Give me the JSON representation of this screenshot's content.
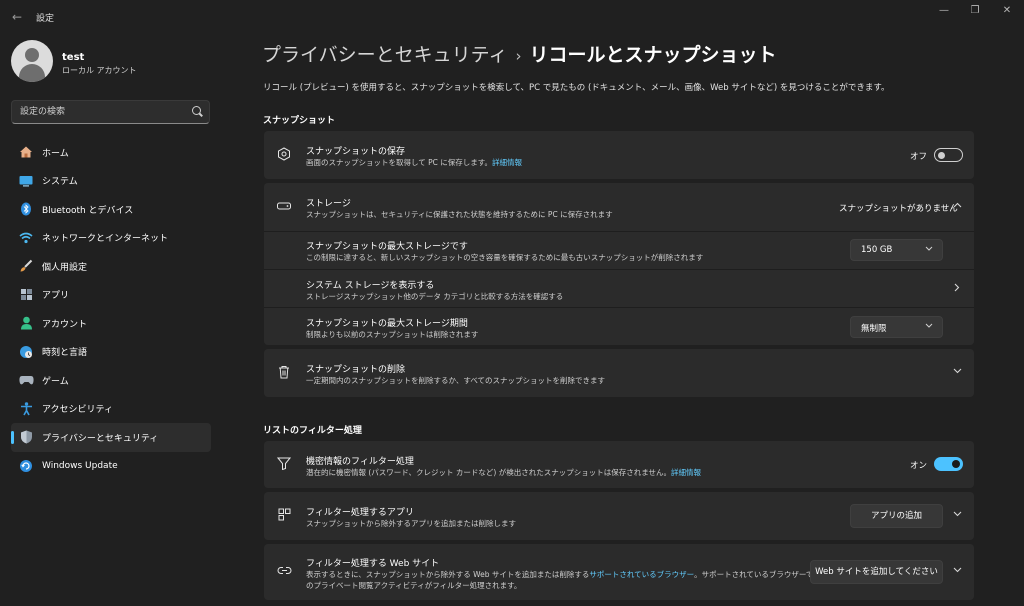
{
  "window": {
    "title": "設定",
    "back": "←",
    "controls": [
      "—",
      "❐",
      "✕"
    ]
  },
  "user": {
    "name": "test",
    "account_type": "ローカル アカウント"
  },
  "search": {
    "placeholder": "設定の検索"
  },
  "sidebar": {
    "items": [
      {
        "label": "ホーム",
        "icon": "home-icon"
      },
      {
        "label": "システム",
        "icon": "system-icon"
      },
      {
        "label": "Bluetooth とデバイス",
        "icon": "bluetooth-icon"
      },
      {
        "label": "ネットワークとインターネット",
        "icon": "network-icon"
      },
      {
        "label": "個人用設定",
        "icon": "brush-icon"
      },
      {
        "label": "アプリ",
        "icon": "apps-icon"
      },
      {
        "label": "アカウント",
        "icon": "account-icon"
      },
      {
        "label": "時刻と言語",
        "icon": "globe-icon"
      },
      {
        "label": "ゲーム",
        "icon": "gamepad-icon"
      },
      {
        "label": "アクセシビリティ",
        "icon": "accessibility-icon"
      },
      {
        "label": "プライバシーとセキュリティ",
        "icon": "shield-icon",
        "active": true
      },
      {
        "label": "Windows Update",
        "icon": "update-icon"
      }
    ]
  },
  "breadcrumb": {
    "parent": "プライバシーとセキュリティ",
    "separator": "›",
    "current": "リコールとスナップショット"
  },
  "intro": "リコール (プレビュー) を使用すると、スナップショットを検索して、PC で見たもの (ドキュメント、メール、画像、Web サイトなど) を見つけることができます。",
  "snapshots_section": {
    "title": "スナップショット",
    "save_setting": {
      "title": "スナップショットの保存",
      "desc": "画面のスナップショットを取得して PC に保存します。",
      "link": "詳細情報",
      "state_label": "オフ",
      "on": false
    },
    "storage": {
      "title": "ストレージ",
      "desc": "スナップショットは、セキュリティに保護された状態を維持するために PC に保存されます",
      "status": "スナップショットがありません",
      "max_storage": {
        "title": "スナップショットの最大ストレージです",
        "desc": "この制限に達すると、新しいスナップショットの空き容量を確保するために最も古いスナップショットが削除されます",
        "value": "150 GB"
      },
      "view_storage": {
        "title": "システム ストレージを表示する",
        "desc": "ストレージスナップショット他のデータ カテゴリと比較する方法を確認する"
      },
      "max_period": {
        "title": "スナップショットの最大ストレージ期間",
        "desc": "制限よりも以前のスナップショットは削除されます",
        "value": "無制限"
      }
    },
    "delete": {
      "title": "スナップショットの削除",
      "desc": "一定期間内のスナップショットを削除するか、すべてのスナップショットを削除できます"
    }
  },
  "filter_section": {
    "title": "リストのフィルター処理",
    "sensitive": {
      "title": "機密情報のフィルター処理",
      "desc": "潜在的に機密情報 (パスワード、クレジット カードなど) が検出されたスナップショットは保存されません。",
      "link": "詳細情報",
      "state_label": "オン",
      "on": true
    },
    "apps": {
      "title": "フィルター処理するアプリ",
      "desc": "スナップショットから除外するアプリを追加または削除します",
      "button": "アプリの追加"
    },
    "websites": {
      "title": "フィルター処理する Web サイト",
      "desc_1": "表示するときに、スナップショットから除外する Web サイトを追加または削除する",
      "link": "サポートされているブラウザー",
      "desc_2": "。サポートされているブラウザーでのすべて",
      "desc_3": "のプライベート閲覧アクティビティがフィルター処理されます。",
      "button": "Web サイトを追加してください"
    }
  },
  "colors": {
    "accent": "#4cc2ff",
    "background": "#202020",
    "card": "#2b2b2b",
    "link": "#62cdff"
  }
}
